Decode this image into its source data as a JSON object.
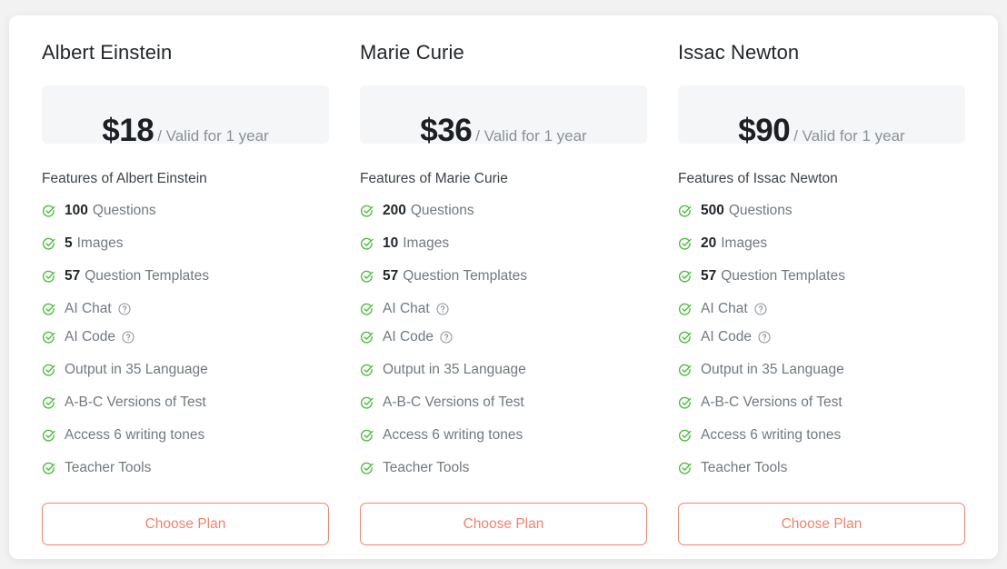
{
  "plans": [
    {
      "title": "Albert Einstein",
      "price": "$18",
      "period": "/ Valid for 1 year",
      "features_heading": "Features of Albert Einstein",
      "features": [
        {
          "value": "100",
          "text": "Questions",
          "help": false
        },
        {
          "value": "5",
          "text": "Images",
          "help": false
        },
        {
          "value": "57",
          "text": "Question Templates",
          "help": false
        },
        {
          "value": "",
          "text": "AI Chat",
          "help": true
        },
        {
          "value": "",
          "text": "AI Code",
          "help": true
        },
        {
          "value": "",
          "text": "Output in 35 Language",
          "help": false
        },
        {
          "value": "",
          "text": "A-B-C Versions of Test",
          "help": false
        },
        {
          "value": "",
          "text": "Access 6 writing tones",
          "help": false
        },
        {
          "value": "",
          "text": "Teacher Tools",
          "help": false
        }
      ],
      "cta": "Choose Plan"
    },
    {
      "title": "Marie Curie",
      "price": "$36",
      "period": "/ Valid for 1 year",
      "features_heading": "Features of Marie Curie",
      "features": [
        {
          "value": "200",
          "text": "Questions",
          "help": false
        },
        {
          "value": "10",
          "text": "Images",
          "help": false
        },
        {
          "value": "57",
          "text": "Question Templates",
          "help": false
        },
        {
          "value": "",
          "text": "AI Chat",
          "help": true
        },
        {
          "value": "",
          "text": "AI Code",
          "help": true
        },
        {
          "value": "",
          "text": "Output in 35 Language",
          "help": false
        },
        {
          "value": "",
          "text": "A-B-C Versions of Test",
          "help": false
        },
        {
          "value": "",
          "text": "Access 6 writing tones",
          "help": false
        },
        {
          "value": "",
          "text": "Teacher Tools",
          "help": false
        }
      ],
      "cta": "Choose Plan"
    },
    {
      "title": "Issac Newton",
      "price": "$90",
      "period": "/ Valid for 1 year",
      "features_heading": "Features of Issac Newton",
      "features": [
        {
          "value": "500",
          "text": "Questions",
          "help": false
        },
        {
          "value": "20",
          "text": "Images",
          "help": false
        },
        {
          "value": "57",
          "text": "Question Templates",
          "help": false
        },
        {
          "value": "",
          "text": "AI Chat",
          "help": true
        },
        {
          "value": "",
          "text": "AI Code",
          "help": true
        },
        {
          "value": "",
          "text": "Output in 35 Language",
          "help": false
        },
        {
          "value": "",
          "text": "A-B-C Versions of Test",
          "help": false
        },
        {
          "value": "",
          "text": "Access 6 writing tones",
          "help": false
        },
        {
          "value": "",
          "text": "Teacher Tools",
          "help": false
        }
      ],
      "cta": "Choose Plan"
    }
  ],
  "icons": {
    "check": "check-circle-icon",
    "help": "help-circle-icon"
  },
  "colors": {
    "check_green": "#4cbb3c",
    "cta_accent": "#f4826a",
    "price_box_bg": "#f5f6f7",
    "muted_text": "#707981",
    "heading_text": "#22272b"
  }
}
